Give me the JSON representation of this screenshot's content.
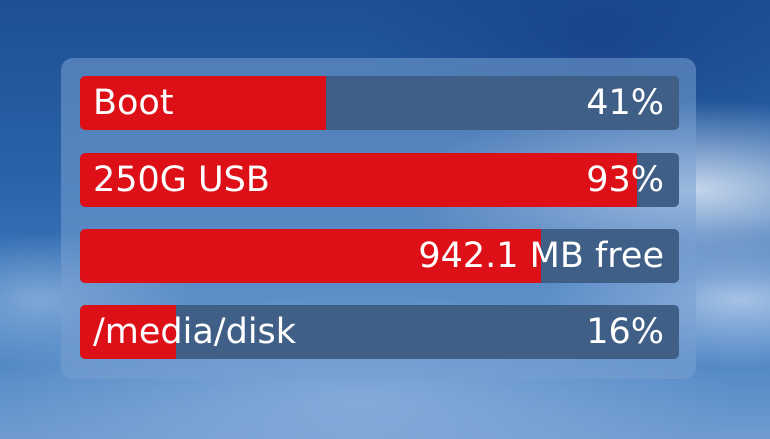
{
  "desktop": {
    "widget": {
      "drives": [
        {
          "label": "Boot",
          "value_text": "41%",
          "used_fraction": 0.41
        },
        {
          "label": "250G USB",
          "value_text": "93%",
          "used_fraction": 0.93
        },
        {
          "label": "",
          "value_text": "942.1 MB free",
          "used_fraction": 0.77
        },
        {
          "label": "/media/disk",
          "value_text": "16%",
          "used_fraction": 0.16
        }
      ],
      "colors": {
        "used": "#de1017",
        "free": "#3f5f86"
      }
    }
  }
}
